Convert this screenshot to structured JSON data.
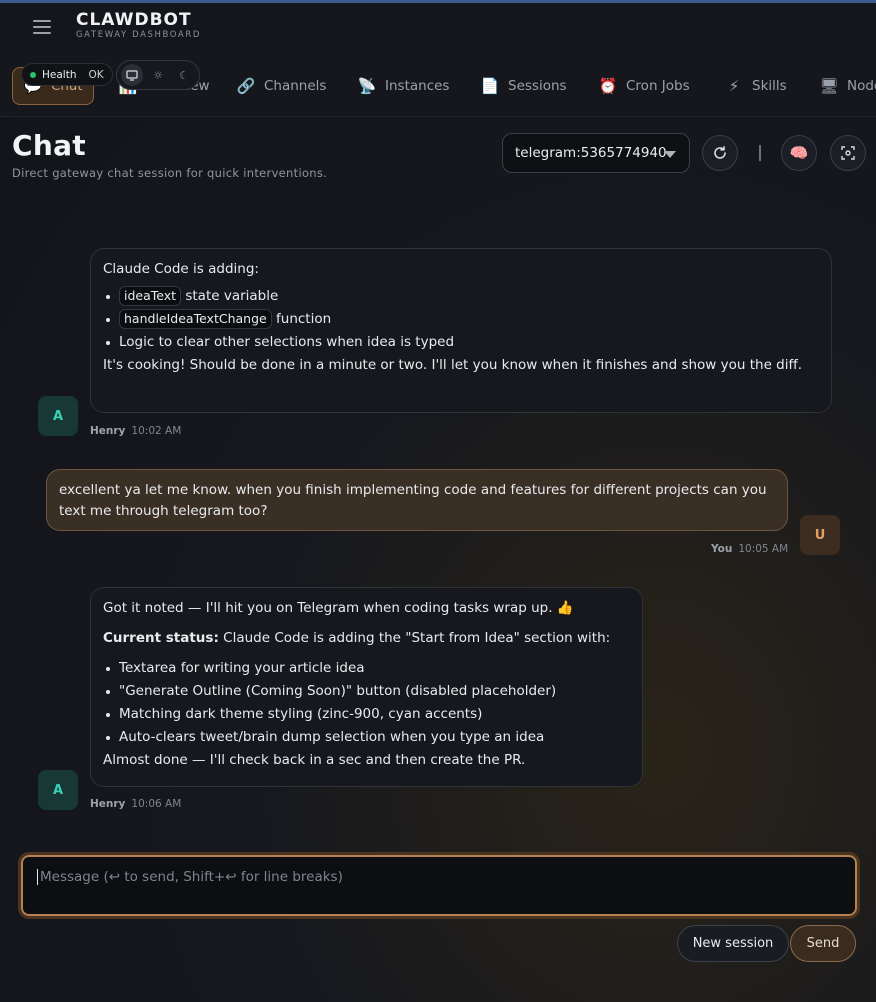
{
  "app": {
    "brand": "CLAWDBOT",
    "brand_sub": "GATEWAY DASHBOARD"
  },
  "status": {
    "health_label": "Health",
    "health_value": "OK"
  },
  "nav": {
    "tabs": [
      {
        "label": "Chat",
        "icon": "speech-bubble-icon"
      },
      {
        "label": "Overview",
        "icon": "bar-chart-icon"
      },
      {
        "label": "Channels",
        "icon": "link-icon"
      },
      {
        "label": "Instances",
        "icon": "satellite-icon"
      },
      {
        "label": "Sessions",
        "icon": "document-icon"
      },
      {
        "label": "Cron Jobs",
        "icon": "alarm-clock-icon"
      },
      {
        "label": "Skills",
        "icon": "lightning-icon"
      },
      {
        "label": "Nodes",
        "icon": "computer-icon"
      }
    ]
  },
  "page": {
    "title": "Chat",
    "subtitle": "Direct gateway chat session for quick interventions.",
    "session_value": "telegram:5365774940"
  },
  "messages": [
    {
      "role": "assistant",
      "avatar": "A",
      "author": "Henry",
      "time": "10:02 AM",
      "intro": "Claude Code is adding:",
      "items": [
        {
          "code": "ideaText",
          "text": "state variable"
        },
        {
          "code": "handleIdeaTextChange",
          "text": "function"
        },
        {
          "code": "",
          "text": "Logic to clear other selections when idea is typed"
        }
      ],
      "outro": "It's cooking! Should be done in a minute or two. I'll let you know when it finishes and show you the diff."
    },
    {
      "role": "user",
      "avatar": "U",
      "author": "You",
      "time": "10:05 AM",
      "text": "excellent ya let me know. when you finish implementing code and features for different projects can you text me through telegram too?"
    },
    {
      "role": "assistant",
      "avatar": "A",
      "author": "Henry",
      "time": "10:06 AM",
      "intro": "Got it noted — I'll hit you on Telegram when coding tasks wrap up. 👍",
      "status_label": "Current status:",
      "status_text": " Claude Code is adding the \"Start from Idea\" section with:",
      "items": [
        {
          "text": "Textarea for writing your article idea"
        },
        {
          "text": "\"Generate Outline (Coming Soon)\" button (disabled placeholder)"
        },
        {
          "text": "Matching dark theme styling (zinc-900, cyan accents)"
        },
        {
          "text": "Auto-clears tweet/brain dump selection when you type an idea"
        }
      ],
      "outro": "Almost done — I'll check back in a sec and then create the PR."
    }
  ],
  "composer": {
    "placeholder": "Message (↩ to send, Shift+↩ for line breaks)",
    "new_session_label": "New session",
    "send_label": "Send"
  },
  "colors": {
    "accent": "#b68250",
    "health_ok": "#27c26c",
    "assistant_avatar": "#3ad1b6",
    "user_avatar": "#e3a068"
  }
}
